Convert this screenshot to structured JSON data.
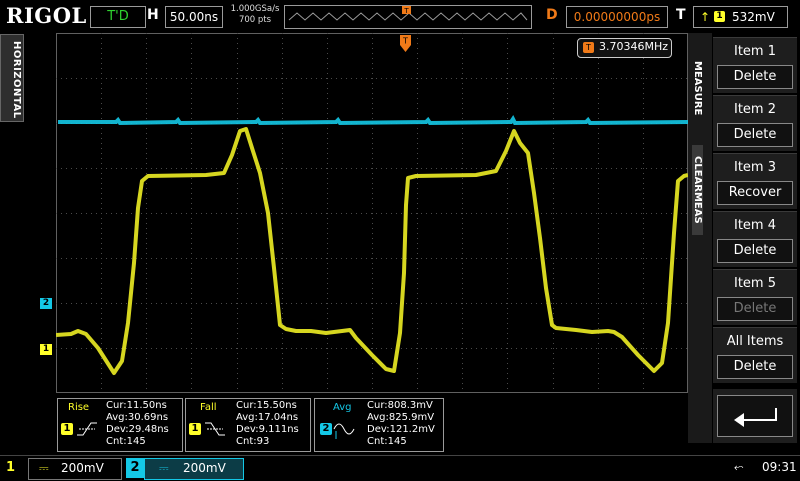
{
  "brand": "RIGOL",
  "top": {
    "trigger_mode": "T'D",
    "h_label": "H",
    "timebase": "50.00ns",
    "sample_rate": "1.000GSa/s",
    "mem_depth": "700 pts",
    "d_label": "D",
    "delay": "0.00000000ps",
    "t_label": "T",
    "trigger_level": "532mV"
  },
  "left_tab": "HORIZONTAL",
  "frequency_readout": "3.70346MHz",
  "channel_markers": {
    "ch1": "1",
    "ch2": "2"
  },
  "menu": {
    "title": "MEASURE",
    "clear_label": "CLEARMEAS",
    "items": [
      {
        "label": "Item 1",
        "action": "Delete",
        "enabled": true
      },
      {
        "label": "Item 2",
        "action": "Delete",
        "enabled": true
      },
      {
        "label": "Item 3",
        "action": "Recover",
        "enabled": true
      },
      {
        "label": "Item 4",
        "action": "Delete",
        "enabled": true
      },
      {
        "label": "Item 5",
        "action": "Delete",
        "enabled": false
      },
      {
        "label": "All Items",
        "action": "Delete",
        "enabled": true
      }
    ],
    "back_icon": "return-arrow-icon"
  },
  "measurements": [
    {
      "name": "Rise",
      "channel": "1",
      "cur": "Cur:11.50ns",
      "avg": "Avg:30.69ns",
      "dev": "Dev:29.48ns",
      "cnt": "Cnt:145"
    },
    {
      "name": "Fall",
      "channel": "1",
      "cur": "Cur:15.50ns",
      "avg": "Avg:17.04ns",
      "dev": "Dev:9.111ns",
      "cnt": "Cnt:93"
    },
    {
      "name": "Avg",
      "channel": "2",
      "cur": "Cur:808.3mV",
      "avg": "Avg:825.9mV",
      "dev": "Dev:121.2mV",
      "cnt": "Cnt:145"
    }
  ],
  "bottom": {
    "ch1_label": "1",
    "ch1_scale": "200mV",
    "ch2_label": "2",
    "ch2_scale": "200mV",
    "time": "09:31"
  },
  "colors": {
    "ch1": "#e6e61e",
    "ch2": "#14c8e6",
    "trigger": "#f07a18",
    "grid": "#505050"
  }
}
